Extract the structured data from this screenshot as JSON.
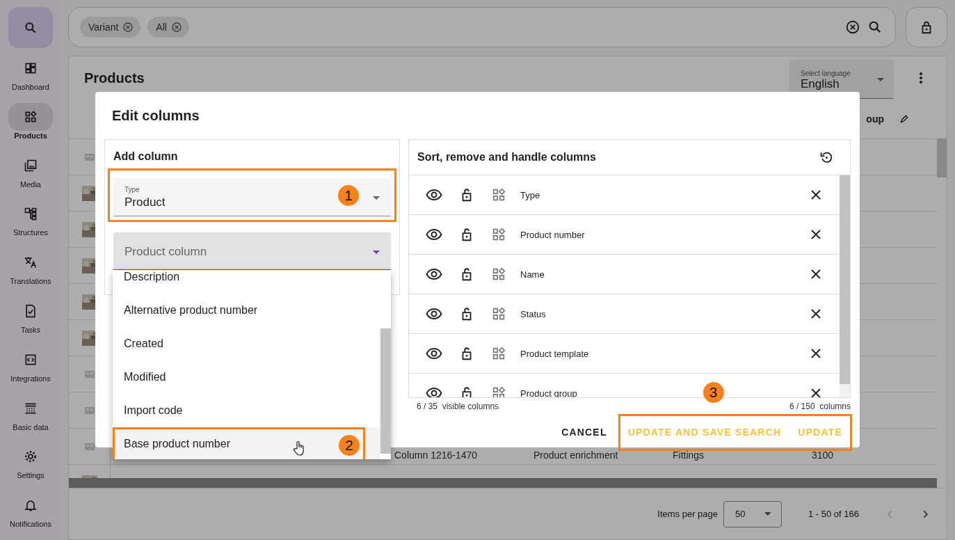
{
  "sidebar": {
    "items": [
      {
        "label": "Dashboard",
        "selected": false
      },
      {
        "label": "Products",
        "selected": true
      },
      {
        "label": "Media",
        "selected": false
      },
      {
        "label": "Structures",
        "selected": false
      },
      {
        "label": "Translations",
        "selected": false
      },
      {
        "label": "Tasks",
        "selected": false
      },
      {
        "label": "Integrations",
        "selected": false
      },
      {
        "label": "Basic data",
        "selected": false
      },
      {
        "label": "Settings",
        "selected": false
      },
      {
        "label": "Notifications",
        "selected": false
      }
    ]
  },
  "search_bar": {
    "chips": [
      {
        "label": "Variant"
      },
      {
        "label": "All"
      }
    ]
  },
  "products": {
    "title": "Products",
    "language": {
      "label": "Select language",
      "value": "English"
    },
    "table": {
      "header": "oup",
      "rows": [
        {
          "kind": "placeholder"
        },
        {
          "kind": "picture"
        },
        {
          "kind": "picture"
        },
        {
          "kind": "picture"
        },
        {
          "kind": "picture"
        },
        {
          "kind": "picture"
        },
        {
          "kind": "placeholder"
        },
        {
          "kind": "placeholder"
        },
        {
          "kind": "placeholder",
          "cells": [
            "Column 1216-1470",
            "Product enrichment",
            "Fittings",
            "3100"
          ]
        },
        {
          "kind": "picture"
        }
      ]
    },
    "pagination": {
      "label": "Items per page",
      "per_page": "50",
      "range": "1 - 50 of 166",
      "previous_disabled": true
    }
  },
  "dialog": {
    "title": "Edit columns",
    "add_column": {
      "title": "Add column",
      "type_field": {
        "label": "Type",
        "value": "Product",
        "callout": "1"
      },
      "column_field": {
        "placeholder": "Product column",
        "focused": true
      },
      "menu": {
        "items": [
          {
            "label": "Description",
            "highlighted": false
          },
          {
            "label": "Alternative product number",
            "highlighted": false
          },
          {
            "label": "Created",
            "highlighted": false
          },
          {
            "label": "Modified",
            "highlighted": false
          },
          {
            "label": "Import code",
            "highlighted": false
          },
          {
            "label": "Base product number",
            "highlighted": true,
            "callout": "2"
          }
        ]
      }
    },
    "columns_panel": {
      "title": "Sort, remove and handle columns",
      "columns": [
        {
          "name": "Type"
        },
        {
          "name": "Product number"
        },
        {
          "name": "Name"
        },
        {
          "name": "Status"
        },
        {
          "name": "Product template"
        },
        {
          "name": "Product group"
        }
      ],
      "visible_count": "6 / 35  visible columns",
      "total_count": "6 / 150  columns"
    },
    "buttons": [
      {
        "label": "CANCEL",
        "kind": "plain"
      },
      {
        "label": "UPDATE AND SAVE SEARCH",
        "kind": "accent"
      },
      {
        "label": "UPDATE",
        "kind": "accent"
      }
    ],
    "buttons_callout": "3"
  }
}
